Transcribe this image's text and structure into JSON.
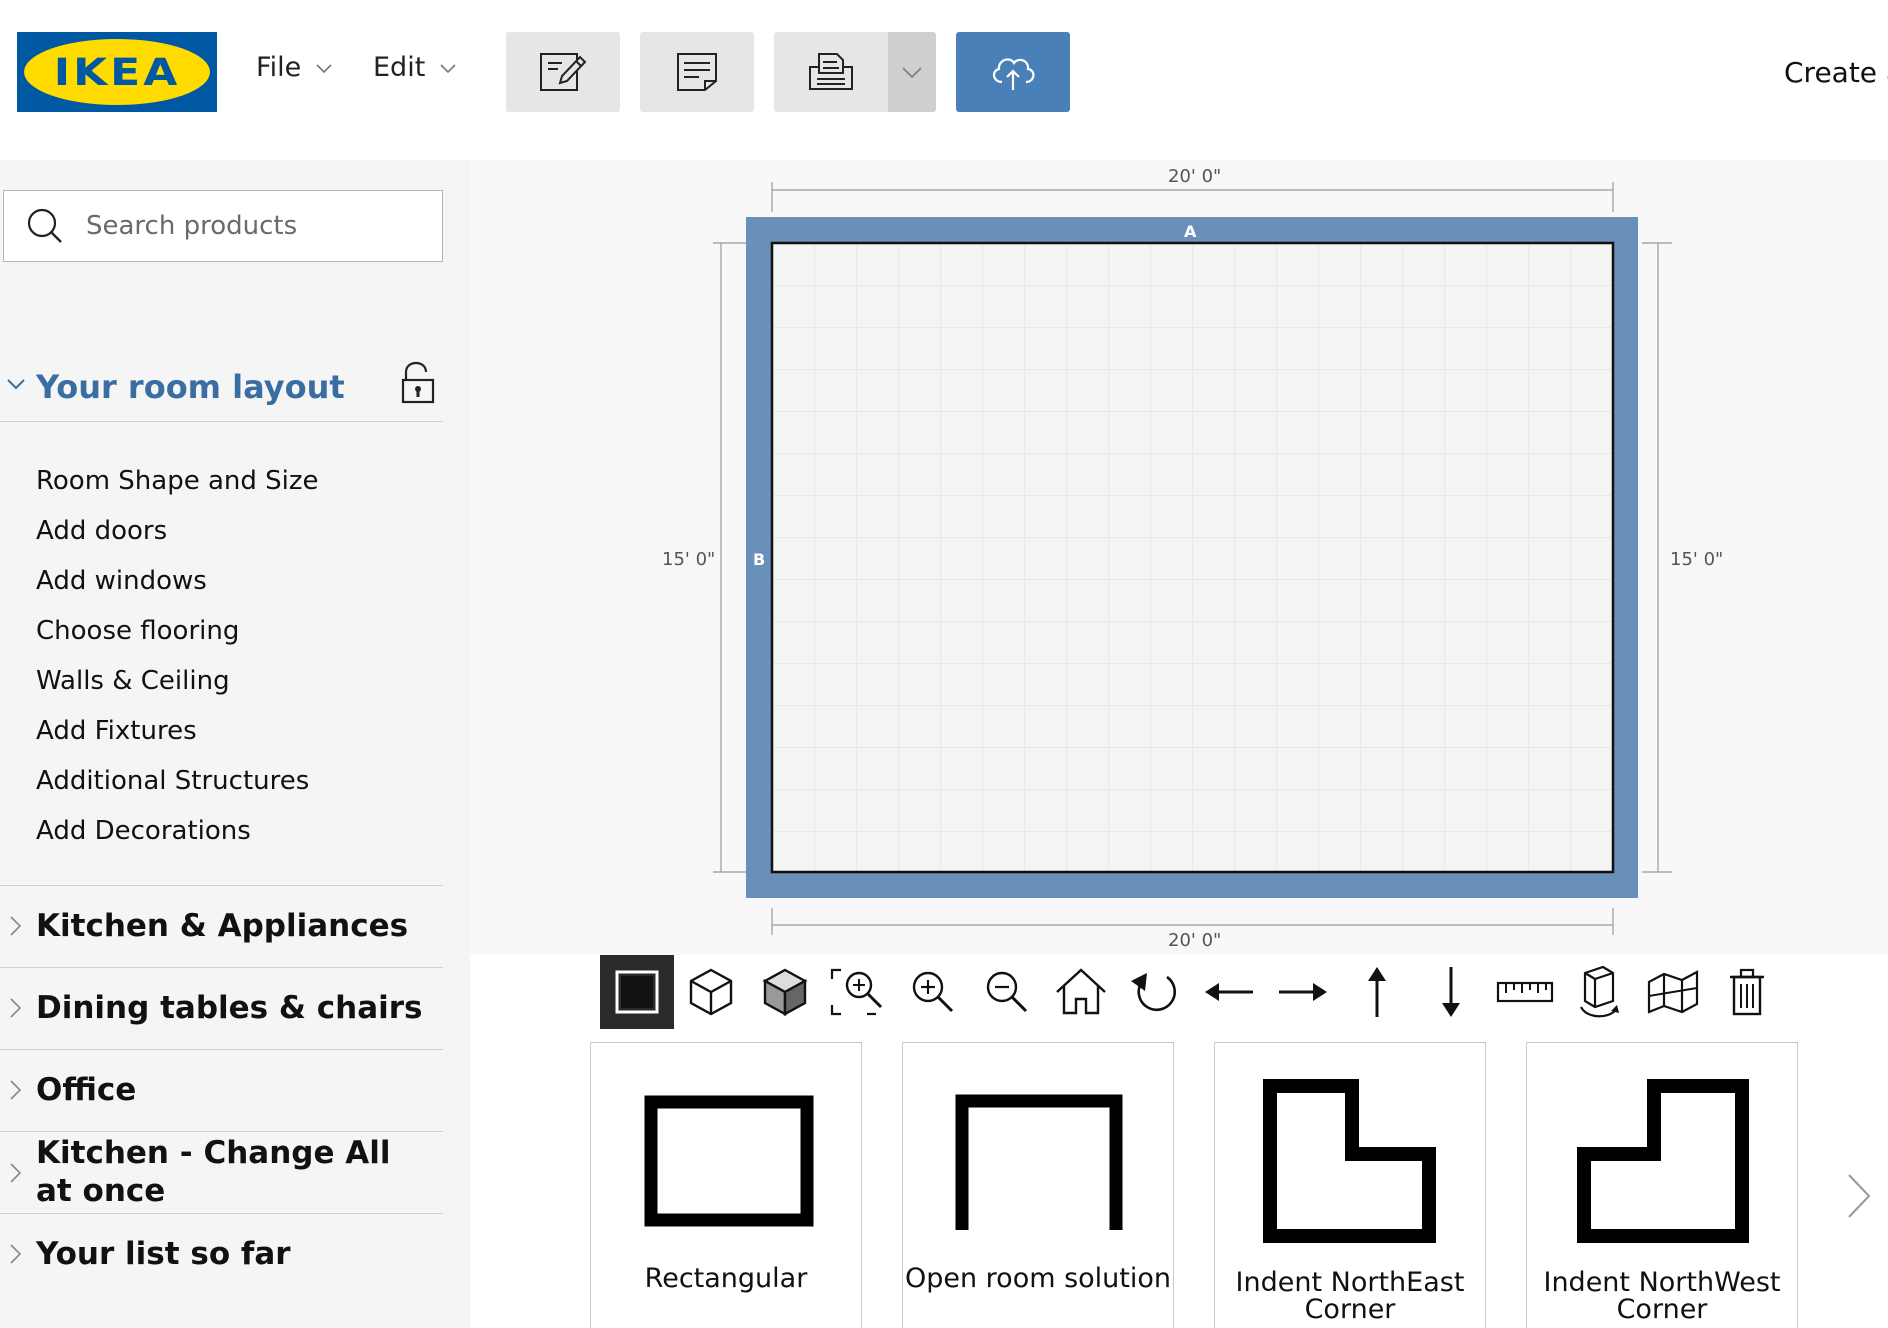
{
  "header": {
    "logo_text": "IKEA",
    "menus": [
      {
        "label": "File"
      },
      {
        "label": "Edit"
      }
    ],
    "toolbar_icons": [
      "edit-icon",
      "notes-icon",
      "print-icon",
      "dropdown-icon",
      "cloud-upload-icon"
    ],
    "create_label": "Create a",
    "colors": {
      "brand_blue": "#0058a3",
      "brand_yellow": "#ffdb00",
      "cloud_button": "#4a80b8"
    }
  },
  "sidebar": {
    "search_placeholder": "Search products",
    "section": {
      "title": "Your room layout",
      "items": [
        "Room Shape and Size",
        "Add doors",
        "Add windows",
        "Choose flooring",
        "Walls & Ceiling",
        "Add Fixtures",
        "Additional Structures",
        "Add Decorations"
      ]
    },
    "categories": [
      {
        "label": "Kitchen & Appliances"
      },
      {
        "label": "Dining tables & chairs"
      },
      {
        "label": "Office"
      },
      {
        "label": "Kitchen - Change All at once"
      },
      {
        "label": "Your list so far"
      }
    ],
    "accent_color": "#3a6ea3"
  },
  "room": {
    "width_label": "20' 0\"",
    "height_label": "15' 0\"",
    "wall_a": "A",
    "wall_b": "B",
    "wall_color": "#6890b8"
  },
  "tools": [
    "2d-view-icon",
    "3d-view-icon",
    "3d-solid-view-icon",
    "zoom-fit-icon",
    "zoom-in-icon",
    "zoom-out-icon",
    "home-icon",
    "rotate-icon",
    "arrow-left-icon",
    "arrow-right-icon",
    "arrow-up-icon",
    "arrow-down-icon",
    "ruler-icon",
    "wall-toggle-icon",
    "wall-3d-icon",
    "trash-icon"
  ],
  "shapes": [
    {
      "label": "Rectangular"
    },
    {
      "label": "Open room solution"
    },
    {
      "label": "Indent NorthEast Corner"
    },
    {
      "label": "Indent NorthWest Corner"
    }
  ]
}
